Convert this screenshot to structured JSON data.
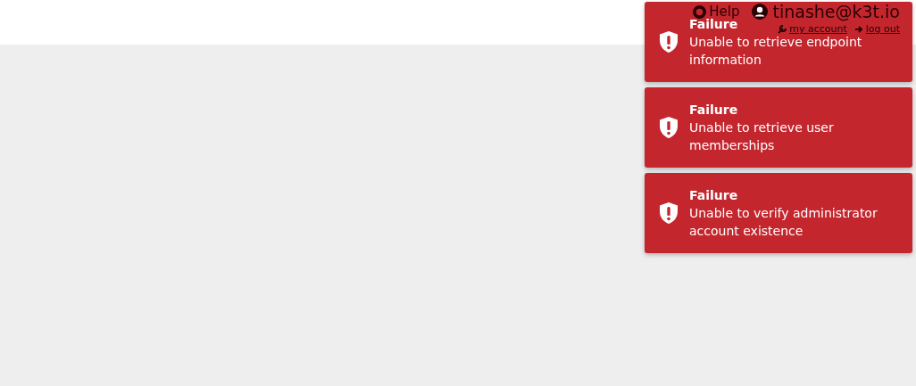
{
  "header": {
    "help": "Help",
    "user": "tinashe@k3t.io",
    "my_account": "my account",
    "log_out": "log out"
  },
  "notifications": [
    {
      "title": "Failure",
      "message": "Unable to retrieve endpoint information"
    },
    {
      "title": "Failure",
      "message": "Unable to retrieve user memberships"
    },
    {
      "title": "Failure",
      "message": "Unable to verify administrator account existence"
    }
  ]
}
